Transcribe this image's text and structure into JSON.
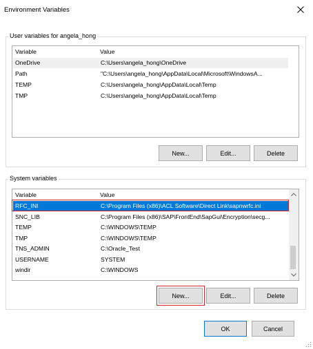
{
  "window": {
    "title": "Environment Variables"
  },
  "user_vars": {
    "group_label": "User variables for angela_hong",
    "headers": {
      "variable": "Variable",
      "value": "Value"
    },
    "rows": [
      {
        "name": "OneDrive",
        "value": "C:\\Users\\angela_hong\\OneDrive"
      },
      {
        "name": "Path",
        "value": "\"C:\\Users\\angela_hong\\AppData\\Local\\Microsoft\\WindowsA..."
      },
      {
        "name": "TEMP",
        "value": "C:\\Users\\angela_hong\\AppData\\Local\\Temp"
      },
      {
        "name": "TMP",
        "value": "C:\\Users\\angela_hong\\AppData\\Local\\Temp"
      }
    ],
    "buttons": {
      "new": "New...",
      "edit": "Edit...",
      "delete": "Delete"
    }
  },
  "system_vars": {
    "group_label": "System variables",
    "headers": {
      "variable": "Variable",
      "value": "Value"
    },
    "rows": [
      {
        "name": "RFC_INI",
        "value": "C:\\Program Files (x86)\\ACL Software\\Direct Link\\sapnwrfc.ini"
      },
      {
        "name": "SNC_LIB",
        "value": "C:\\Program Files (x86)\\SAP\\FrontEnd\\SapGui\\Encryption\\secg..."
      },
      {
        "name": "TEMP",
        "value": "C:\\WINDOWS\\TEMP"
      },
      {
        "name": "TMP",
        "value": "C:\\WINDOWS\\TEMP"
      },
      {
        "name": "TNS_ADMIN",
        "value": "C:\\Oracle_Test"
      },
      {
        "name": "USERNAME",
        "value": "SYSTEM"
      },
      {
        "name": "windir",
        "value": "C:\\WINDOWS"
      }
    ],
    "selected_row": "RFC_INI",
    "buttons": {
      "new": "New...",
      "edit": "Edit...",
      "delete": "Delete"
    }
  },
  "dialog_buttons": {
    "ok": "OK",
    "cancel": "Cancel"
  },
  "colors": {
    "selection": "#0078d7",
    "highlight": "#d2232a",
    "button_face": "#e1e1e1"
  },
  "icons": {
    "close": "close-icon",
    "scroll_up": "chevron-up-icon",
    "scroll_down": "chevron-down-icon",
    "grip": "resize-grip-icon"
  }
}
